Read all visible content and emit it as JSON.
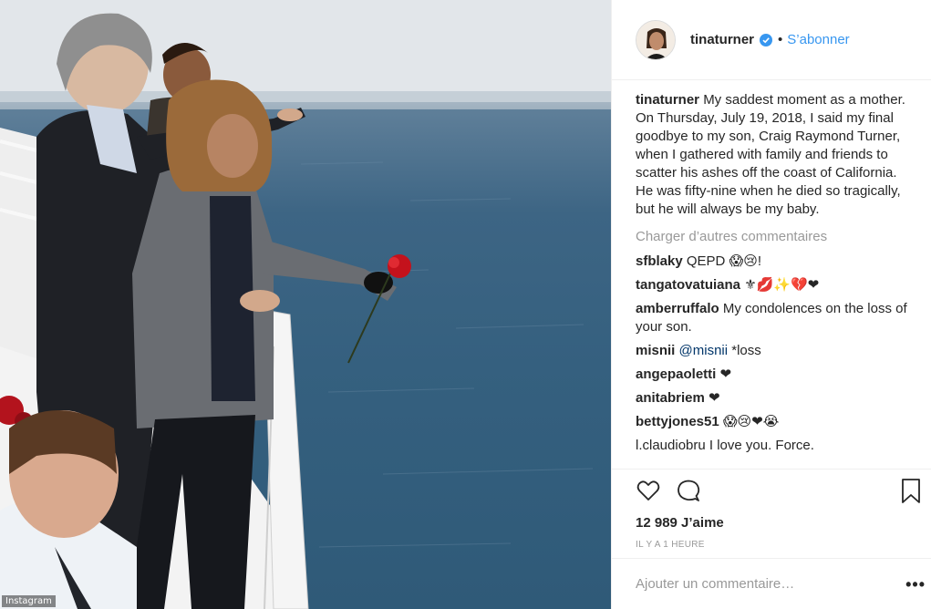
{
  "photo": {
    "credit": "Instagram"
  },
  "post": {
    "username": "tinaturner",
    "follow_label": "S’abonner",
    "dot": "•",
    "caption_user": "tinaturner",
    "caption_text": "My saddest moment as a mother. On Thursday, July 19, 2018, I said my final goodbye to my son, Craig Raymond Turner, when I gathered with family and friends to scatter his ashes off the coast of California. He was fifty-nine when he died so tragically, but he will always be my baby.",
    "load_more_label": "Charger d’autres commentaires",
    "comments": [
      {
        "user": "sfblaky",
        "text": "QEPD 😱😢!"
      },
      {
        "user": "tangatovatuiana",
        "text": "⚜💋✨💔❤"
      },
      {
        "user": "amberruffalo",
        "text": "My condolences on the loss of your son."
      },
      {
        "user": "misnii",
        "mention": "@misnii",
        "text": "*loss"
      },
      {
        "user": "angepaoletti",
        "text": "❤"
      },
      {
        "user": "anitabriem",
        "text": "❤"
      },
      {
        "user": "bettyjones51",
        "text": "😱😢❤😭"
      },
      {
        "user": "l.claudiobru",
        "text": "I love you. Force."
      }
    ],
    "likes": "12 989 J’aime",
    "timestamp": "IL Y A 1 HEURE",
    "comment_placeholder": "Ajouter un commentaire…",
    "more_options": "•••"
  },
  "colors": {
    "link_blue": "#3897f0",
    "verified_blue": "#3897f0",
    "muted": "#999999",
    "text": "#262626"
  },
  "icons": [
    "verified-badge-icon",
    "heart-icon",
    "comment-icon",
    "bookmark-icon",
    "more-options-icon"
  ]
}
